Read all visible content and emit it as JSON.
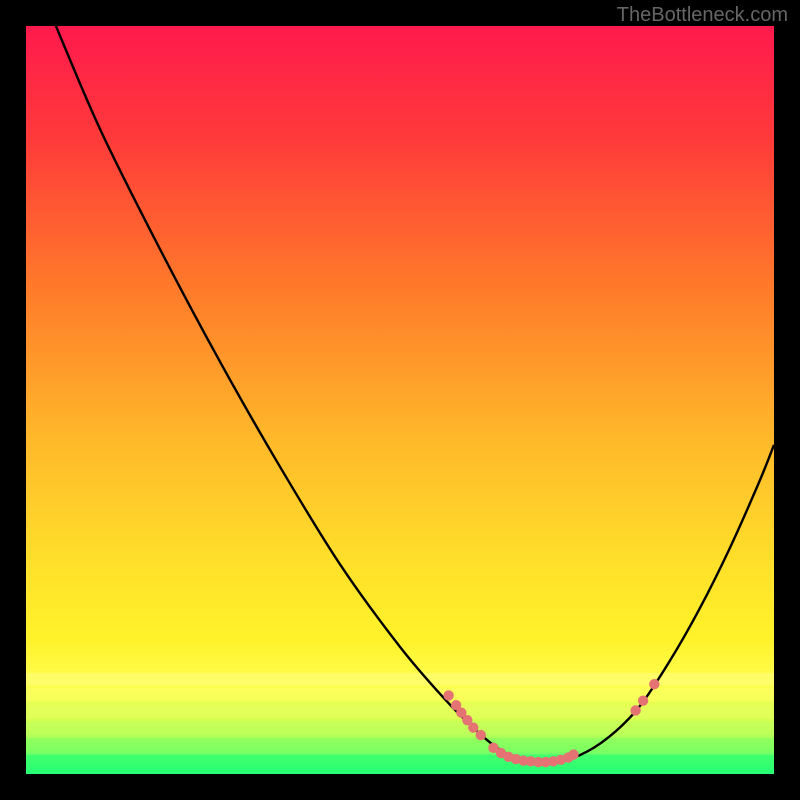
{
  "watermark": "TheBottleneck.com",
  "chart_data": {
    "type": "line",
    "title": "",
    "xlabel": "",
    "ylabel": "",
    "xlim": [
      0,
      100
    ],
    "ylim": [
      0,
      100
    ],
    "gradient_background": {
      "description": "vertical gradient red-orange-yellow-green with horizontal banding near bottom",
      "stops": [
        {
          "offset": 0,
          "color": "#ff1a4d"
        },
        {
          "offset": 15,
          "color": "#ff3a3a"
        },
        {
          "offset": 35,
          "color": "#ff7a2a"
        },
        {
          "offset": 55,
          "color": "#ffb82a"
        },
        {
          "offset": 72,
          "color": "#ffe02a"
        },
        {
          "offset": 82,
          "color": "#fff22a"
        },
        {
          "offset": 88,
          "color": "#fffe50"
        },
        {
          "offset": 94,
          "color": "#c8ff50"
        },
        {
          "offset": 100,
          "color": "#2aff7a"
        }
      ],
      "band_rows": [
        {
          "y_pct": 86.5,
          "h_pct": 1.6,
          "color": "#fffe80"
        },
        {
          "y_pct": 88.5,
          "h_pct": 1.8,
          "color": "#ffff60"
        },
        {
          "y_pct": 90.8,
          "h_pct": 1.8,
          "color": "#e8ff60"
        },
        {
          "y_pct": 93.0,
          "h_pct": 1.8,
          "color": "#c0ff60"
        },
        {
          "y_pct": 95.2,
          "h_pct": 1.8,
          "color": "#80ff60"
        },
        {
          "y_pct": 97.4,
          "h_pct": 2.6,
          "color": "#20ff70"
        }
      ]
    },
    "series": [
      {
        "name": "bottleneck-curve",
        "type": "line",
        "color": "#000000",
        "points_xy": [
          [
            4,
            0
          ],
          [
            10,
            14
          ],
          [
            18,
            30
          ],
          [
            26,
            45
          ],
          [
            34,
            59
          ],
          [
            42,
            72
          ],
          [
            50,
            83
          ],
          [
            56,
            90
          ],
          [
            60,
            94
          ],
          [
            63,
            96.5
          ],
          [
            66,
            98
          ],
          [
            70,
            98.5
          ],
          [
            74,
            97.5
          ],
          [
            78,
            95
          ],
          [
            82,
            91
          ],
          [
            86,
            85
          ],
          [
            90,
            78
          ],
          [
            94,
            70
          ],
          [
            98,
            61
          ],
          [
            100,
            56
          ]
        ]
      }
    ],
    "marker_clusters": [
      {
        "name": "left-descent-markers",
        "color": "#e57373",
        "points_xy": [
          [
            56.5,
            89.5
          ],
          [
            57.5,
            90.8
          ],
          [
            58.2,
            91.8
          ],
          [
            59.0,
            92.8
          ],
          [
            59.8,
            93.8
          ],
          [
            60.8,
            94.8
          ]
        ]
      },
      {
        "name": "valley-floor-markers",
        "color": "#e57373",
        "points_xy": [
          [
            62.5,
            96.5
          ],
          [
            63.5,
            97.2
          ],
          [
            64.5,
            97.7
          ],
          [
            65.5,
            98.0
          ],
          [
            66.5,
            98.2
          ],
          [
            67.5,
            98.3
          ],
          [
            68.5,
            98.4
          ],
          [
            69.5,
            98.4
          ],
          [
            70.5,
            98.3
          ],
          [
            71.5,
            98.1
          ],
          [
            72.5,
            97.8
          ],
          [
            73.2,
            97.4
          ]
        ]
      },
      {
        "name": "right-ascent-markers",
        "color": "#e57373",
        "points_xy": [
          [
            81.5,
            91.5
          ],
          [
            82.5,
            90.2
          ],
          [
            84.0,
            88.0
          ]
        ]
      }
    ]
  }
}
